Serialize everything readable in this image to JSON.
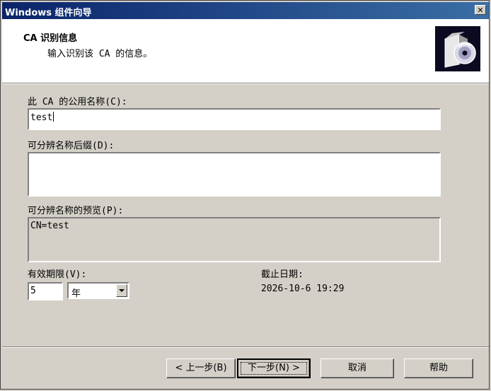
{
  "window": {
    "title": "Windows 组件向导",
    "close_symbol": "✕"
  },
  "header": {
    "title": "CA 识别信息",
    "subtitle": "输入识别该 CA 的信息。",
    "icon": "wizard-package-cd-icon"
  },
  "form": {
    "common_name_label": "此 CA 的公用名称(C):",
    "common_name_value": "test",
    "dn_suffix_label": "可分辨名称后缀(D):",
    "dn_suffix_value": "",
    "dn_preview_label": "可分辨名称的预览(P):",
    "dn_preview_value": "CN=test",
    "validity_label": "有效期限(V):",
    "validity_value": "5",
    "validity_unit": "年",
    "expiry_label": "截止日期:",
    "expiry_value": "2026-10-6 19:29"
  },
  "buttons": {
    "back": "< 上一步(B)",
    "next": "下一步(N) >",
    "cancel": "取消",
    "help": "帮助"
  },
  "colors": {
    "titlebar_start": "#0a246a",
    "titlebar_end": "#3a6ea5",
    "dialog_bg": "#d4d0c8"
  }
}
